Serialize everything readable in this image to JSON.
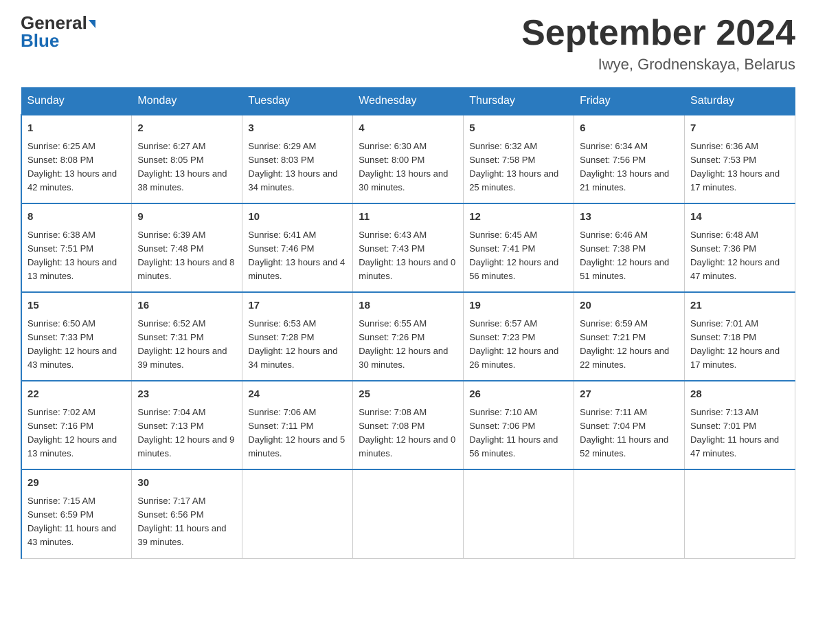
{
  "header": {
    "logo_general": "General",
    "logo_blue": "Blue",
    "title": "September 2024",
    "subtitle": "Iwye, Grodnenskaya, Belarus"
  },
  "days": [
    "Sunday",
    "Monday",
    "Tuesday",
    "Wednesday",
    "Thursday",
    "Friday",
    "Saturday"
  ],
  "weeks": [
    [
      {
        "num": "1",
        "sunrise": "6:25 AM",
        "sunset": "8:08 PM",
        "daylight": "13 hours and 42 minutes."
      },
      {
        "num": "2",
        "sunrise": "6:27 AM",
        "sunset": "8:05 PM",
        "daylight": "13 hours and 38 minutes."
      },
      {
        "num": "3",
        "sunrise": "6:29 AM",
        "sunset": "8:03 PM",
        "daylight": "13 hours and 34 minutes."
      },
      {
        "num": "4",
        "sunrise": "6:30 AM",
        "sunset": "8:00 PM",
        "daylight": "13 hours and 30 minutes."
      },
      {
        "num": "5",
        "sunrise": "6:32 AM",
        "sunset": "7:58 PM",
        "daylight": "13 hours and 25 minutes."
      },
      {
        "num": "6",
        "sunrise": "6:34 AM",
        "sunset": "7:56 PM",
        "daylight": "13 hours and 21 minutes."
      },
      {
        "num": "7",
        "sunrise": "6:36 AM",
        "sunset": "7:53 PM",
        "daylight": "13 hours and 17 minutes."
      }
    ],
    [
      {
        "num": "8",
        "sunrise": "6:38 AM",
        "sunset": "7:51 PM",
        "daylight": "13 hours and 13 minutes."
      },
      {
        "num": "9",
        "sunrise": "6:39 AM",
        "sunset": "7:48 PM",
        "daylight": "13 hours and 8 minutes."
      },
      {
        "num": "10",
        "sunrise": "6:41 AM",
        "sunset": "7:46 PM",
        "daylight": "13 hours and 4 minutes."
      },
      {
        "num": "11",
        "sunrise": "6:43 AM",
        "sunset": "7:43 PM",
        "daylight": "13 hours and 0 minutes."
      },
      {
        "num": "12",
        "sunrise": "6:45 AM",
        "sunset": "7:41 PM",
        "daylight": "12 hours and 56 minutes."
      },
      {
        "num": "13",
        "sunrise": "6:46 AM",
        "sunset": "7:38 PM",
        "daylight": "12 hours and 51 minutes."
      },
      {
        "num": "14",
        "sunrise": "6:48 AM",
        "sunset": "7:36 PM",
        "daylight": "12 hours and 47 minutes."
      }
    ],
    [
      {
        "num": "15",
        "sunrise": "6:50 AM",
        "sunset": "7:33 PM",
        "daylight": "12 hours and 43 minutes."
      },
      {
        "num": "16",
        "sunrise": "6:52 AM",
        "sunset": "7:31 PM",
        "daylight": "12 hours and 39 minutes."
      },
      {
        "num": "17",
        "sunrise": "6:53 AM",
        "sunset": "7:28 PM",
        "daylight": "12 hours and 34 minutes."
      },
      {
        "num": "18",
        "sunrise": "6:55 AM",
        "sunset": "7:26 PM",
        "daylight": "12 hours and 30 minutes."
      },
      {
        "num": "19",
        "sunrise": "6:57 AM",
        "sunset": "7:23 PM",
        "daylight": "12 hours and 26 minutes."
      },
      {
        "num": "20",
        "sunrise": "6:59 AM",
        "sunset": "7:21 PM",
        "daylight": "12 hours and 22 minutes."
      },
      {
        "num": "21",
        "sunrise": "7:01 AM",
        "sunset": "7:18 PM",
        "daylight": "12 hours and 17 minutes."
      }
    ],
    [
      {
        "num": "22",
        "sunrise": "7:02 AM",
        "sunset": "7:16 PM",
        "daylight": "12 hours and 13 minutes."
      },
      {
        "num": "23",
        "sunrise": "7:04 AM",
        "sunset": "7:13 PM",
        "daylight": "12 hours and 9 minutes."
      },
      {
        "num": "24",
        "sunrise": "7:06 AM",
        "sunset": "7:11 PM",
        "daylight": "12 hours and 5 minutes."
      },
      {
        "num": "25",
        "sunrise": "7:08 AM",
        "sunset": "7:08 PM",
        "daylight": "12 hours and 0 minutes."
      },
      {
        "num": "26",
        "sunrise": "7:10 AM",
        "sunset": "7:06 PM",
        "daylight": "11 hours and 56 minutes."
      },
      {
        "num": "27",
        "sunrise": "7:11 AM",
        "sunset": "7:04 PM",
        "daylight": "11 hours and 52 minutes."
      },
      {
        "num": "28",
        "sunrise": "7:13 AM",
        "sunset": "7:01 PM",
        "daylight": "11 hours and 47 minutes."
      }
    ],
    [
      {
        "num": "29",
        "sunrise": "7:15 AM",
        "sunset": "6:59 PM",
        "daylight": "11 hours and 43 minutes."
      },
      {
        "num": "30",
        "sunrise": "7:17 AM",
        "sunset": "6:56 PM",
        "daylight": "11 hours and 39 minutes."
      },
      null,
      null,
      null,
      null,
      null
    ]
  ]
}
